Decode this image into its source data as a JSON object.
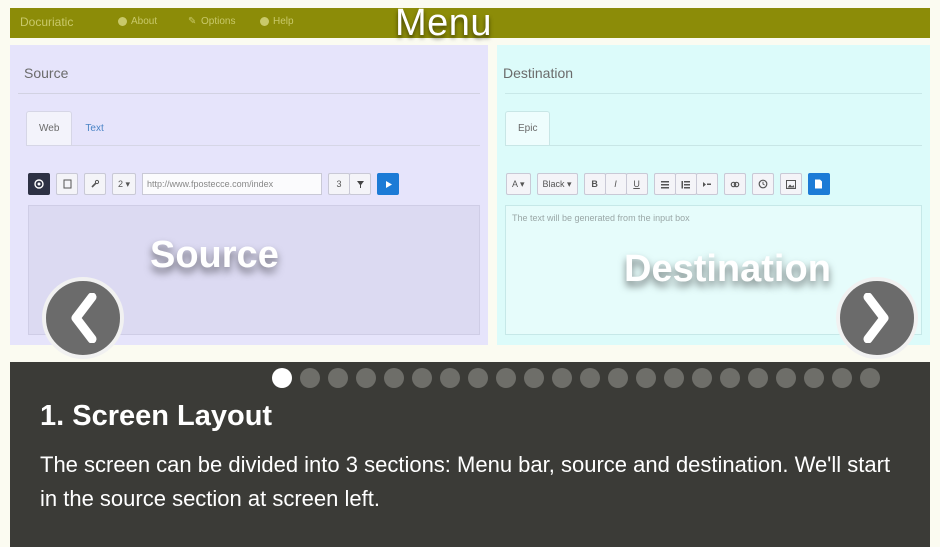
{
  "menubar": {
    "brand": "Docuriatic",
    "items": [
      {
        "label": "About",
        "icon": "info-icon"
      },
      {
        "label": "Options",
        "icon": "wrench-icon"
      },
      {
        "label": "Help",
        "icon": "help-icon"
      }
    ],
    "overlay_label": "Menu",
    "color": "#8c8c08"
  },
  "source": {
    "title": "Source",
    "tabs": [
      "Web",
      "Text"
    ],
    "toolbar": {
      "zoom": "2 ▾",
      "url_value": "http://www.fpostecce.com/index",
      "count": "3"
    },
    "overlay_label": "Source",
    "bg": "#e6e4fb"
  },
  "destination": {
    "title": "Destination",
    "tabs": [
      "Epic"
    ],
    "toolbar": {
      "font_size": "A ▾",
      "font_color": "Black ▾",
      "bold": "B",
      "italic": "I",
      "underline": "U"
    },
    "placeholder": "The text will be generated from the input box",
    "overlay_label": "Destination",
    "bg": "#dcfbfa"
  },
  "carousel": {
    "prev_icon": "chevron-left-icon",
    "next_icon": "chevron-right-icon",
    "total_slides": 22,
    "active_slide": 1
  },
  "caption": {
    "title": "1. Screen Layout",
    "text": "The screen can be divided into 3 sections: Menu bar, source and destination. We'll start in the source section at screen left."
  }
}
